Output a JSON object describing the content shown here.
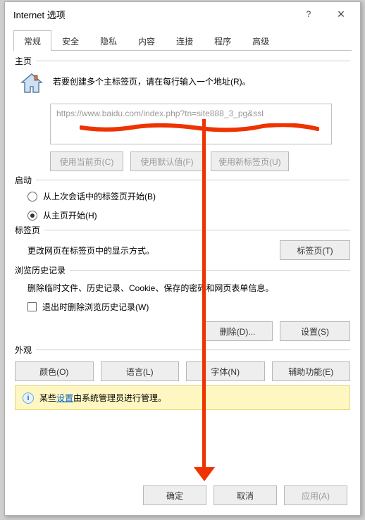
{
  "window": {
    "title": "Internet 选项",
    "help_icon": "?",
    "close_icon": "×"
  },
  "tabs": {
    "items": [
      {
        "label": "常规",
        "active": true
      },
      {
        "label": "安全"
      },
      {
        "label": "隐私"
      },
      {
        "label": "内容"
      },
      {
        "label": "连接"
      },
      {
        "label": "程序"
      },
      {
        "label": "高级"
      }
    ]
  },
  "homepage": {
    "group_title": "主页",
    "instruction": "若要创建多个主标签页，请在每行输入一个地址(R)。",
    "url": "https://www.baidu.com/index.php?tn=site888_3_pg&ssl",
    "btn_current": "使用当前页(C)",
    "btn_default": "使用默认值(F)",
    "btn_newtab": "使用新标签页(U)"
  },
  "startup": {
    "group_title": "启动",
    "opt_last_session": "从上次会话中的标签页开始(B)",
    "opt_home": "从主页开始(H)",
    "selected": "home"
  },
  "tabsSection": {
    "group_title": "标签页",
    "desc": "更改网页在标签页中的显示方式。",
    "btn": "标签页(T)"
  },
  "history": {
    "group_title": "浏览历史记录",
    "desc": "删除临时文件、历史记录、Cookie、保存的密码和网页表单信息。",
    "checkbox": "退出时删除浏览历史记录(W)",
    "btn_delete": "删除(D)...",
    "btn_settings": "设置(S)"
  },
  "appearance": {
    "group_title": "外观",
    "btn_colors": "颜色(O)",
    "btn_lang": "语言(L)",
    "btn_fonts": "字体(N)",
    "btn_access": "辅助功能(E)"
  },
  "infobar": {
    "prefix": "某些",
    "link": "设置",
    "suffix": "由系统管理员进行管理。"
  },
  "footer": {
    "ok": "确定",
    "cancel": "取消",
    "apply": "应用(A)"
  }
}
